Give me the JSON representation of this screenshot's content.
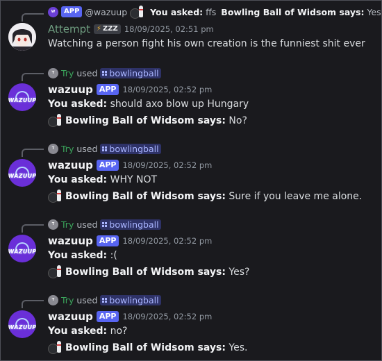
{
  "messages": [
    {
      "reply": {
        "mention": "@wazuup",
        "you_asked": "You asked:",
        "question": "ffs",
        "bot_says": "Bowling Ball of Widsom says:",
        "answer": "Yes?",
        "app_tag": "APP"
      },
      "author": "Attempt",
      "badge": "ZZZ",
      "timestamp": "18/09/2025, 02:51 pm",
      "text": "Watching a person fight his own creation is the funniest shit ever"
    },
    {
      "reply": {
        "user": "Try",
        "used": "used",
        "command": "bowlingball"
      },
      "author": "wazuup",
      "app_tag": "APP",
      "timestamp": "18/09/2025, 02:52 pm",
      "you_asked_label": "You asked:",
      "question": "should axo blow up Hungary",
      "bot_label": "Bowling Ball of Widsom says:",
      "answer": "No?"
    },
    {
      "reply": {
        "user": "Try",
        "used": "used",
        "command": "bowlingball"
      },
      "author": "wazuup",
      "app_tag": "APP",
      "timestamp": "18/09/2025, 02:52 pm",
      "you_asked_label": "You asked:",
      "question": "WHY NOT",
      "bot_label": "Bowling Ball of Widsom says:",
      "answer": "Sure if you leave me alone."
    },
    {
      "reply": {
        "user": "Try",
        "used": "used",
        "command": "bowlingball"
      },
      "author": "wazuup",
      "app_tag": "APP",
      "timestamp": "18/09/2025, 02:52 pm",
      "you_asked_label": "You asked:",
      "question": ":(",
      "bot_label": "Bowling Ball of Widsom says:",
      "answer": "Yes?"
    },
    {
      "reply": {
        "user": "Try",
        "used": "used",
        "command": "bowlingball"
      },
      "author": "wazuup",
      "app_tag": "APP",
      "timestamp": "18/09/2025, 02:52 pm",
      "you_asked_label": "You asked:",
      "question": "no?",
      "bot_label": "Bowling Ball of Widsom says:",
      "answer": "Yes."
    }
  ],
  "avatar_logo_text": "WAZUUP",
  "colors": {
    "background": "#1a1a1e",
    "app_tag": "#5865f2",
    "reply_user": "#3ba55c",
    "command_pill": "#2e3267",
    "avatar": "#6a2fd8"
  }
}
